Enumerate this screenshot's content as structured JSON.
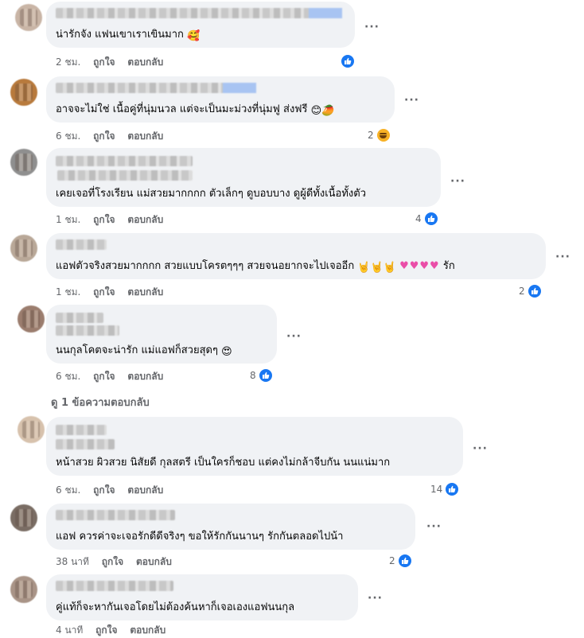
{
  "comments": [
    {
      "text": "น่ารักจัง แฟนเขาเราเขินมาก",
      "emoji": "🥰",
      "time": "2 ชม.",
      "like": "ถูกใจ",
      "reply": "ตอบกลับ",
      "reaction_count": "",
      "reaction_icon": "like-icon"
    },
    {
      "text": "อาจจะไม่ใช่ เนื้อคู่ที่นุ่มนวล แต่จะเป็นมะม่วงที่นุ่มฟู ส่งฟรี",
      "emoji": "😊🥭",
      "time": "6 ชม.",
      "like": "ถูกใจ",
      "reply": "ตอบกลับ",
      "reaction_count": "2",
      "reaction_icon": "haha-icon"
    },
    {
      "text": "เคยเจอที่โรงเรียน แม่สวยมากกกก ตัวเล็กๆ ดูบอบบาง ดูผู้ดีทั้งเนื้อทั้งตัว",
      "emoji": "",
      "time": "1 ชม.",
      "like": "ถูกใจ",
      "reply": "ตอบกลับ",
      "reaction_count": "4",
      "reaction_icon": "like-icon"
    },
    {
      "text": "แอฟตัวจริงสวยมากกกก สวยแบบโครตๆๆๆ สวยจนอยากจะไปเจออีก",
      "emoji": "🤘🤘🤘",
      "hearts": "♥♥♥♥",
      "suffix": "รัก",
      "time": "1 ชม.",
      "like": "ถูกใจ",
      "reply": "ตอบกลับ",
      "reaction_count": "2",
      "reaction_icon": "like-icon"
    },
    {
      "text": "นนกุลโคตจะน่ารัก แม่แอฟก็สวยสุดๆ",
      "emoji": "😍",
      "time": "6 ชม.",
      "like": "ถูกใจ",
      "reply": "ตอบกลับ",
      "reaction_count": "8",
      "reaction_icon": "like-icon"
    },
    {
      "text": "หน้าสวย ผิวสวย นิสัยดี กุลสตรี เป็นใครก็ชอบ แต่คงไม่กล้าจีบกัน นนแน่มาก",
      "emoji": "",
      "time": "6 ชม.",
      "like": "ถูกใจ",
      "reply": "ตอบกลับ",
      "reaction_count": "14",
      "reaction_icon": "like-icon"
    },
    {
      "text": "แอฟ ควรค่าจะเจอรักดีดีจริงๆ ขอให้รักกันนานๆ รักกันตลอดไปน้า",
      "emoji": "",
      "time": "38 นาที",
      "like": "ถูกใจ",
      "reply": "ตอบกลับ",
      "reaction_count": "2",
      "reaction_icon": "like-icon"
    },
    {
      "text": "คู่แท้ก็จะหากันเจอโดยไม่ต้องค้นหาก็เจอเองแอฟนนกุล",
      "emoji": "",
      "time": "4 นาที",
      "like": "ถูกใจ",
      "reply": "ตอบกลับ",
      "reaction_count": "",
      "reaction_icon": ""
    }
  ],
  "view_replies": "ดู 1 ข้อความตอบกลับ",
  "more_icon": "more-options-icon",
  "colors": {
    "like_blue": "#1877f2",
    "bubble": "#f0f2f5",
    "meta_gray": "#65676b"
  }
}
